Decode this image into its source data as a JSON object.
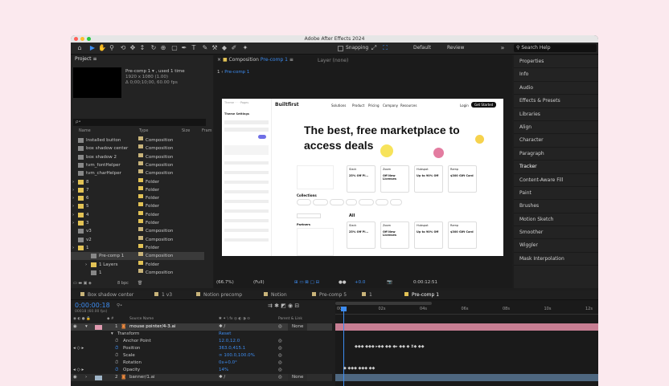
{
  "window": {
    "title": "Adobe After Effects 2024"
  },
  "toolbar": {
    "snapping": "Snapping",
    "workspaces": [
      "Default",
      "Review"
    ],
    "search_placeholder": "Search Help"
  },
  "project": {
    "panel_title": "Project",
    "selected_name": "Pre-comp 1 ▾ , used 1 time",
    "info_line1": "1920 x 1080 (1.00)",
    "info_line2": "Δ 0;00;10;00, 60.00 fps",
    "search_placeholder": "ρ•",
    "columns": {
      "name": "Name",
      "type": "Type",
      "size": "Size",
      "frame": "Fram"
    },
    "items": [
      {
        "name": "Installed button",
        "type": "Composition",
        "color": "#c9b47a"
      },
      {
        "name": "box shadow center",
        "type": "Composition",
        "color": "#c9b47a"
      },
      {
        "name": "box shadow 2",
        "type": "Composition",
        "color": "#c9b47a"
      },
      {
        "name": "tvm_fontHelper",
        "type": "Composition",
        "color": "#c9b47a"
      },
      {
        "name": "tvm_charHelper",
        "type": "Composition",
        "color": "#c9b47a"
      },
      {
        "name": "8",
        "type": "Folder",
        "color": "#e2c255"
      },
      {
        "name": "7",
        "type": "Folder",
        "color": "#e2c255"
      },
      {
        "name": "6",
        "type": "Folder",
        "color": "#e2c255"
      },
      {
        "name": "5",
        "type": "Folder",
        "color": "#e2c255"
      },
      {
        "name": "4",
        "type": "Folder",
        "color": "#e2c255"
      },
      {
        "name": "3",
        "type": "Folder",
        "color": "#e2c255"
      },
      {
        "name": "v3",
        "type": "Composition",
        "color": "#c9b47a"
      },
      {
        "name": "v2",
        "type": "Composition",
        "color": "#c9b47a"
      },
      {
        "name": "1",
        "type": "Folder",
        "color": "#e2c255"
      },
      {
        "name": "Pre-comp 1",
        "type": "Composition",
        "color": "#c9b47a"
      },
      {
        "name": "1 Layers",
        "type": "Folder",
        "color": "#e2c255"
      },
      {
        "name": "1",
        "type": "Composition",
        "color": "#c9b47a"
      }
    ],
    "bpc": "8 bpc"
  },
  "composition": {
    "tab_label": "Composition",
    "tab_name": "Pre-comp 1",
    "layer_label": "Layer (none)",
    "breadcrumb_num": "1",
    "breadcrumb": "Pre-comp 1",
    "zoom": "(66.7%)",
    "resolution": "(Full)",
    "exposure": "+0.0",
    "timecode": "0:00:12:51"
  },
  "website": {
    "logo": "Builtfirst",
    "nav": [
      "Solutions",
      "Product",
      "Pricing",
      "Company",
      "Resources"
    ],
    "login": "Login",
    "cta": "Get Started",
    "headline": "The best, free marketplace to access deals",
    "side_header": "Theme Settings",
    "collections_label": "Collections",
    "all_label": "All",
    "partners_label": "Partners",
    "top_cards": [
      {
        "name": "Slack",
        "deal": "25% Off Pl..."
      },
      {
        "name": "Zoom",
        "deal": "Off New Licenses"
      },
      {
        "name": "Hubspot",
        "deal": "Up to 90% Off"
      },
      {
        "name": "Ramp",
        "deal": "$300 Gift Card"
      }
    ],
    "bottom_cards": [
      {
        "name": "Slack",
        "deal": "25% Off Pl..."
      },
      {
        "name": "Zoom",
        "deal": "Off New Licenses"
      },
      {
        "name": "Hubspot",
        "deal": "Up to 90% Off"
      },
      {
        "name": "Ramp",
        "deal": "$300 Gift Card"
      }
    ]
  },
  "right_panel": {
    "items": [
      "Properties",
      "Info",
      "Audio",
      "Effects & Presets",
      "Libraries",
      "Align",
      "Character",
      "Paragraph",
      "Tracker",
      "Content-Aware Fill",
      "Paint",
      "Brushes",
      "Motion Sketch",
      "Smoother",
      "Wiggler",
      "Mask Interpolation"
    ]
  },
  "timeline": {
    "tabs": [
      "Box shadow center",
      "1 v3",
      "Notion precomp",
      "Notion",
      "Pre-comp 5",
      "1",
      "Pre-comp 1"
    ],
    "timecode": "0:00:00:18",
    "fps_info": "00018 (60.00 fps)",
    "col_source": "Source Name",
    "col_parent": "Parent & Link",
    "ruler": [
      "00s",
      "02s",
      "04s",
      "06s",
      "08s",
      "10s",
      "12s"
    ],
    "layer1": {
      "num": "1",
      "name": "mouse pointer/4-3.ai",
      "parent": "None"
    },
    "transform_label": "Transform",
    "reset_label": "Reset",
    "props": [
      {
        "name": "Anchor Point",
        "value": "12.0,12.0"
      },
      {
        "name": "Position",
        "value": "363.0,415.1"
      },
      {
        "name": "Scale",
        "value": "∞ 100.0,100.0%"
      },
      {
        "name": "Rotation",
        "value": "0x+0.0°"
      },
      {
        "name": "Opacity",
        "value": "14%"
      }
    ],
    "layer2": {
      "num": "2",
      "name": "banner/1.ai",
      "parent": "None"
    }
  }
}
